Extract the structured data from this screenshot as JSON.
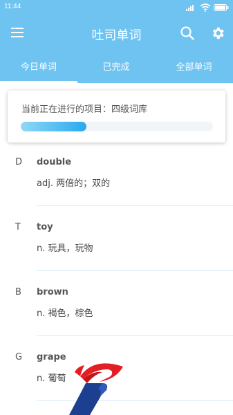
{
  "status_bar": {
    "time": "11:44"
  },
  "app_bar": {
    "title": "吐司单词",
    "menu_icon": "menu-icon",
    "search_icon": "search-icon",
    "settings_icon": "gear-icon"
  },
  "tabs": [
    {
      "label": "今日单词",
      "active": true
    },
    {
      "label": "已完成",
      "active": false
    },
    {
      "label": "全部单词",
      "active": false
    }
  ],
  "progress": {
    "label": "当前正在进行的项目：四级词库",
    "fraction": 0.34
  },
  "words": [
    {
      "letter": "D",
      "word": "double",
      "meaning": "adj. 两倍的；双的"
    },
    {
      "letter": "T",
      "word": "toy",
      "meaning": "n. 玩具，玩物"
    },
    {
      "letter": "B",
      "word": "brown",
      "meaning": "n. 褐色，棕色"
    },
    {
      "letter": "G",
      "word": "grape",
      "meaning": "n. 葡萄"
    }
  ],
  "colors": {
    "primary": "#6fc3f1",
    "progress_fill": "#29a9ee",
    "divider": "#d6ecf8"
  }
}
